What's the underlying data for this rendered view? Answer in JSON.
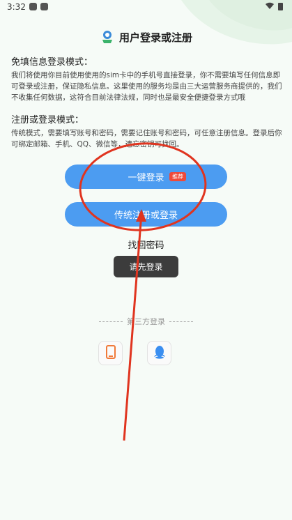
{
  "status_bar": {
    "time": "3:32"
  },
  "header": {
    "title": "用户登录或注册",
    "logo_icon": "app-logo-icon"
  },
  "free_login": {
    "title": "免填信息登录模式：",
    "body": "我们将使用你目前使用使用的sim卡中的手机号直接登录，你不需要填写任何信息即可登录或注册，保证隐私信息。这里使用的服务均是由三大运营服务商提供的，我们不收集任何数据，这符合目前法律法规，同时也是最安全便捷登录方式哦"
  },
  "register_login": {
    "title": "注册或登录模式：",
    "body": "传统模式，需要填写账号和密码，需要记住账号和密码，可任意注册信息。登录后你可绑定邮箱、手机、QQ、微信等，遗忘密钥可找回。"
  },
  "buttons": {
    "one_click": "一键登录",
    "one_click_badge": "推荐",
    "traditional": "传统注册或登录",
    "find_password": "找回密码"
  },
  "toast": {
    "text": "请先登录"
  },
  "third_party": {
    "label": "第三方登录",
    "items": [
      "phone-icon",
      "qq-icon"
    ]
  },
  "colors": {
    "primary": "#4c9cf1",
    "badge": "#ef4a3a",
    "annotation": "#e0341f",
    "toast_bg": "#3c3c3c",
    "phone_icon": "#f07a3a",
    "qq_icon": "#3a8ef0"
  }
}
